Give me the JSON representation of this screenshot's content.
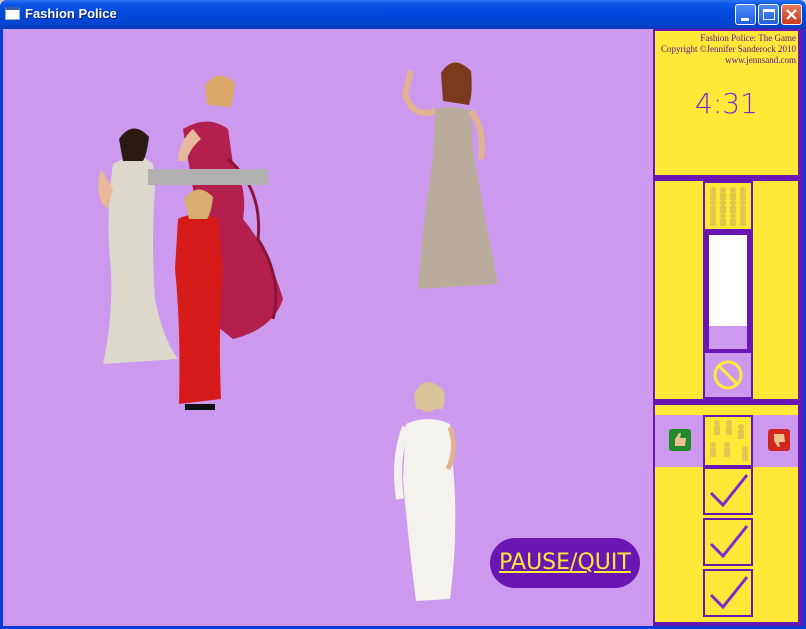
{
  "window": {
    "title": "Fashion Police"
  },
  "credits": {
    "line1": "Fashion Police: The Game",
    "line2": "Copyright ©Jennifer Sanderock 2010",
    "line3": "www.jennsand.com"
  },
  "timer": "4:31",
  "buttons": {
    "pause_quit": "PAUSE/QUIT"
  },
  "meter": {
    "fill_fraction": 0.2
  },
  "colors": {
    "stage": "#cc99ee",
    "panel": "#ffe838",
    "frame": "#6a16b3"
  },
  "icons": {
    "thumbs_up": "thumbs-up-icon",
    "thumbs_down": "thumbs-down-icon",
    "no_entry": "no-entry-icon",
    "check": "checkmark-icon",
    "crowd": "crowd-icon"
  }
}
